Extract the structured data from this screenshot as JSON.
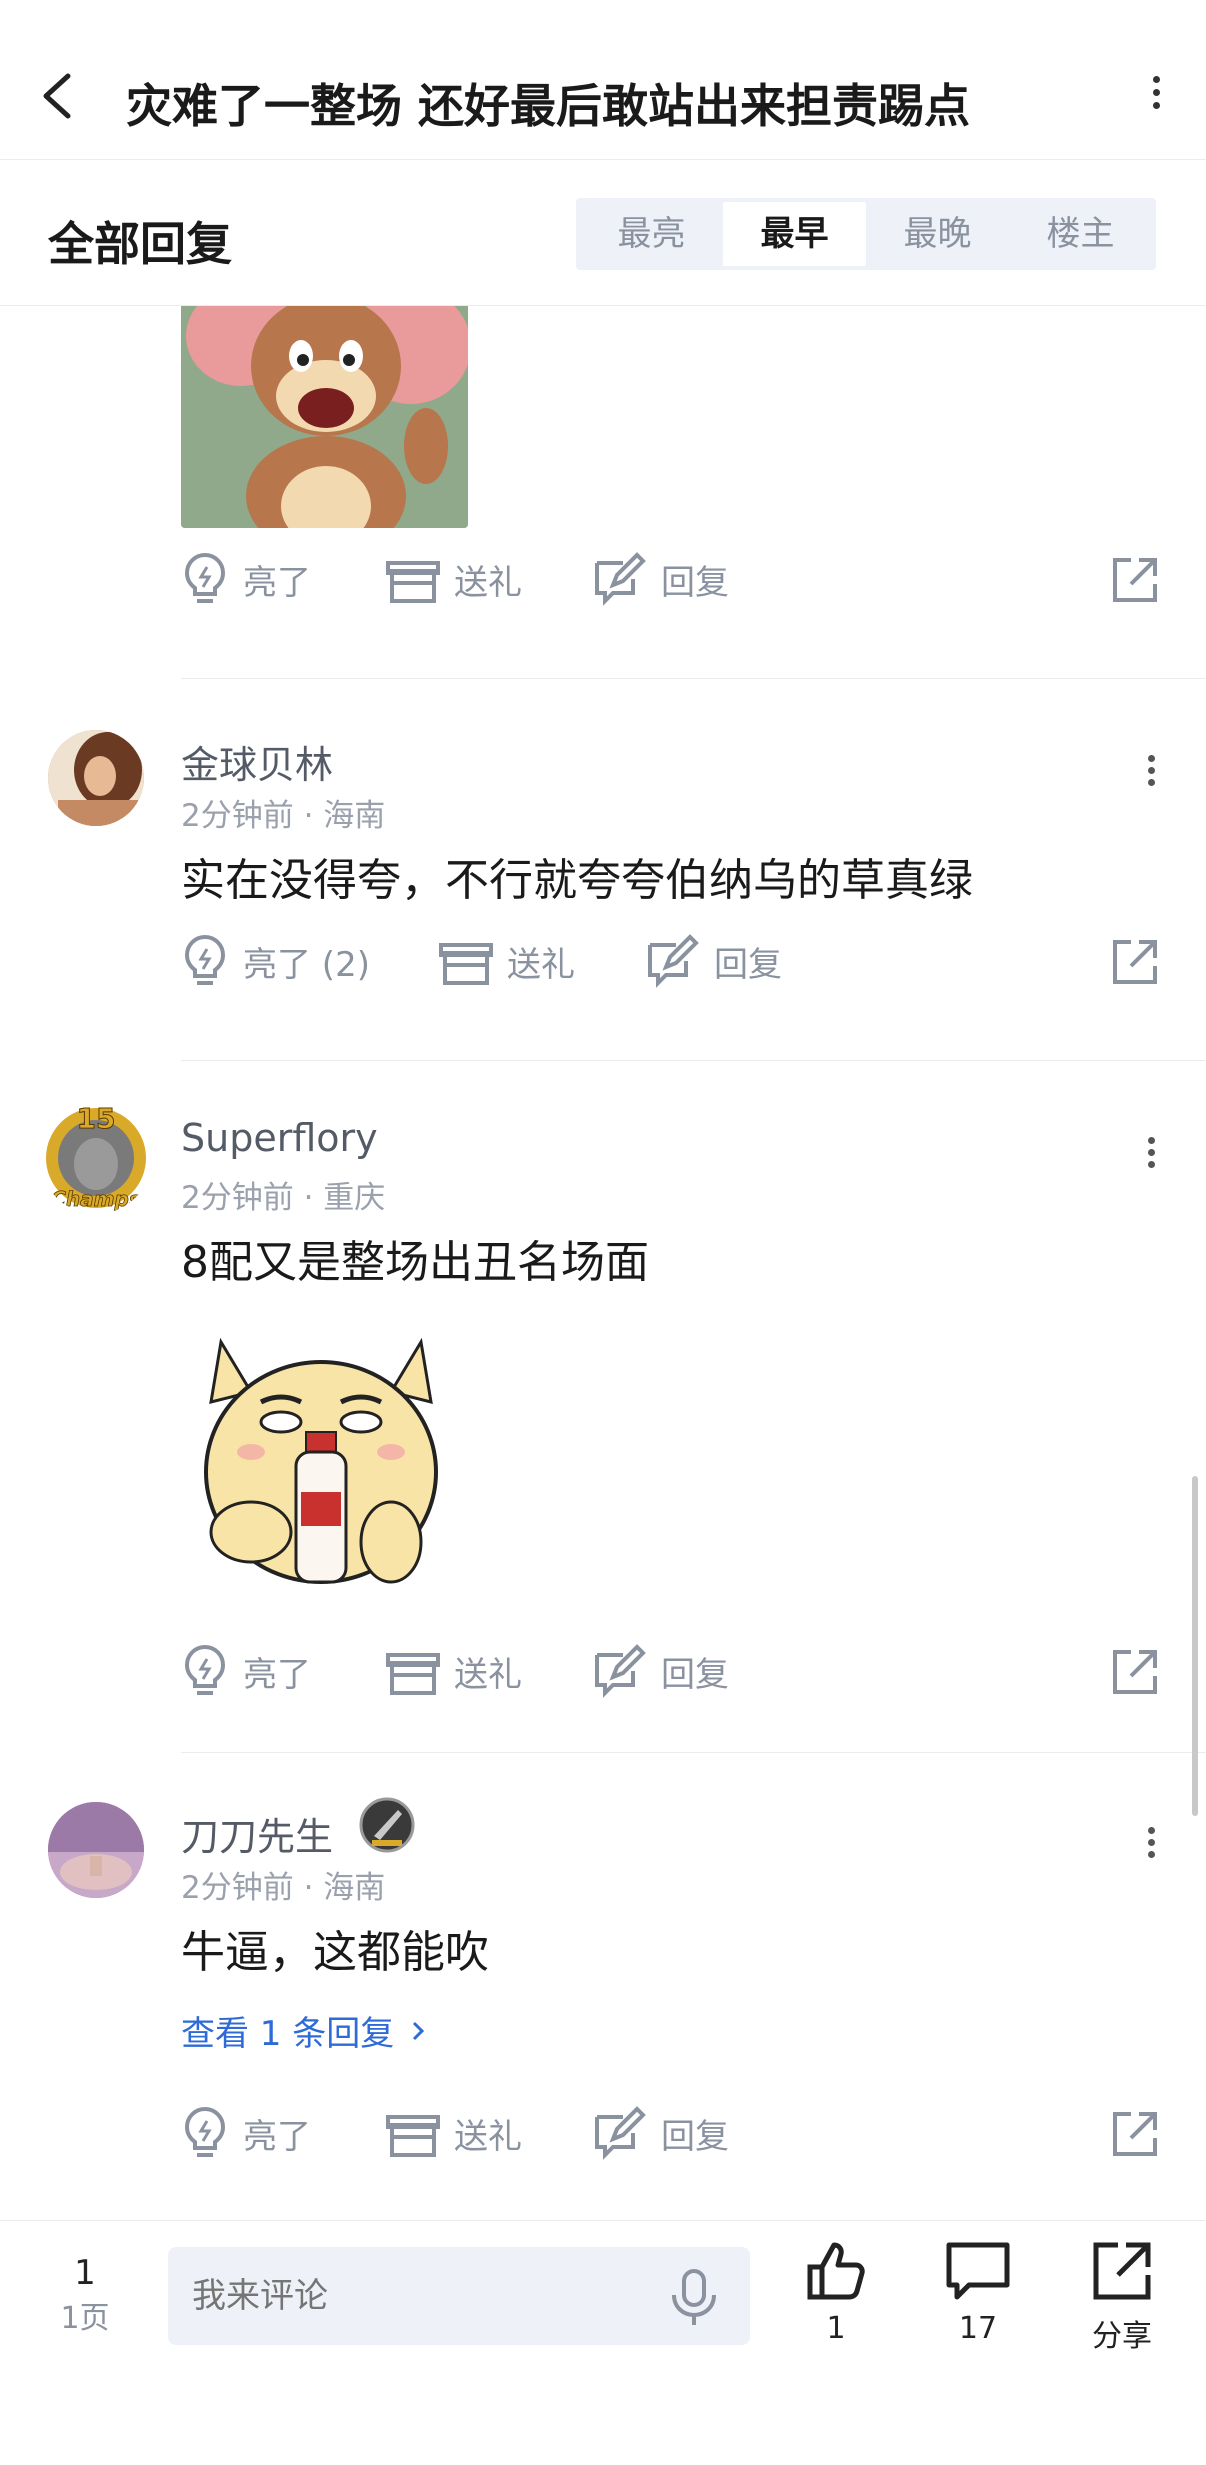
{
  "header": {
    "title": "灾难了一整场 还好最后敢站出来担责踢点"
  },
  "sort": {
    "title": "全部回复",
    "options": [
      "最亮",
      "最早",
      "最晚",
      "楼主"
    ],
    "selected": "最早"
  },
  "actions_labels": {
    "like": "亮了",
    "gift": "送礼",
    "reply": "回复"
  },
  "comments": [
    {
      "username": "金球贝林",
      "time": "2分钟前",
      "location": "海南",
      "meta": "2分钟前 · 海南",
      "content": "实在没得夸，不行就夸夸伯纳乌的草真绿",
      "like_label": "亮了 (2)"
    },
    {
      "username": "Superflory",
      "time": "2分钟前",
      "location": "重庆",
      "meta": "2分钟前 · 重庆",
      "content": "8配又是整场出丑名场面",
      "badge_text": "15",
      "badge_sub": "Champs"
    },
    {
      "username": "刀刀先生",
      "time": "2分钟前",
      "location": "海南",
      "meta": "2分钟前 · 海南",
      "content": "牛逼，这都能吹",
      "view_replies": "查看 1 条回复"
    }
  ],
  "bottom": {
    "page_number": "1",
    "page_label": "1页",
    "input_placeholder": "我来评论",
    "like_count": "1",
    "comment_count": "17",
    "share_label": "分享"
  },
  "colors": {
    "accent_link": "#2f6bd6",
    "muted": "#8a92a0",
    "segment_bg": "#eef2f8"
  }
}
